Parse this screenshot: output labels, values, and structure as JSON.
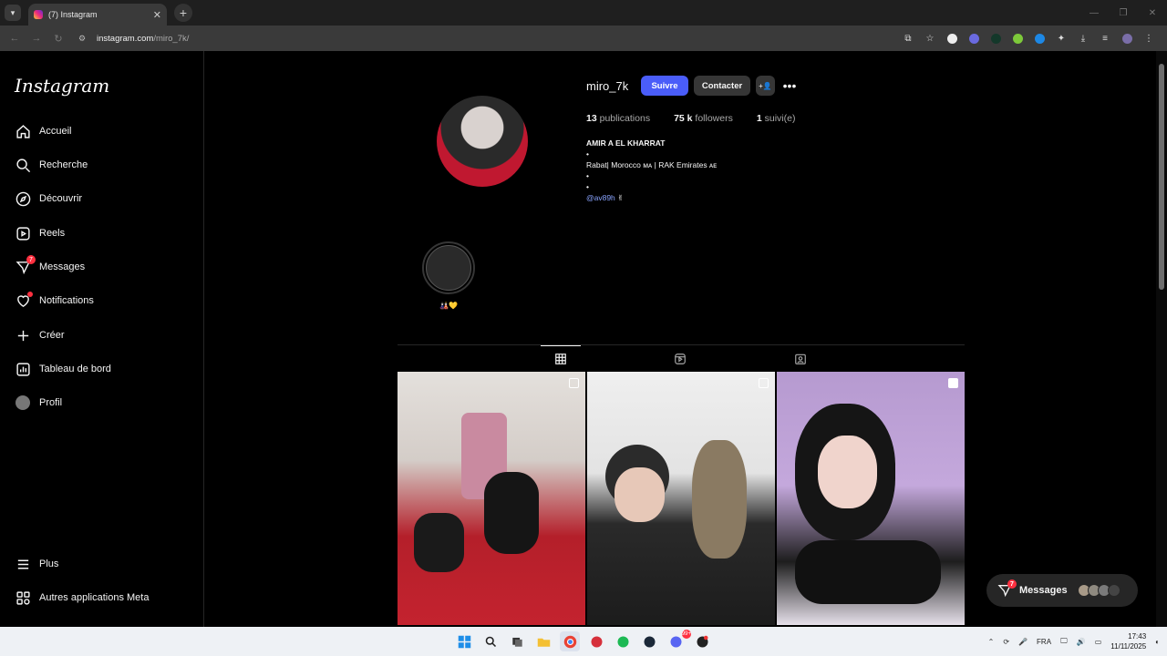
{
  "browser": {
    "tab_title": "(7) Instagram",
    "url_host": "instagram.com",
    "url_path": "/miro_7k/"
  },
  "sidebar": {
    "logo": "Instagram",
    "items": [
      {
        "label": "Accueil",
        "icon": "home-icon"
      },
      {
        "label": "Recherche",
        "icon": "search-icon"
      },
      {
        "label": "Découvrir",
        "icon": "compass-icon"
      },
      {
        "label": "Reels",
        "icon": "reels-icon"
      },
      {
        "label": "Messages",
        "icon": "messenger-icon",
        "badge": "7"
      },
      {
        "label": "Notifications",
        "icon": "heart-icon"
      },
      {
        "label": "Créer",
        "icon": "plus-icon"
      },
      {
        "label": "Tableau de bord",
        "icon": "dashboard-icon"
      },
      {
        "label": "Profil",
        "icon": "avatar"
      }
    ],
    "bottom_items": [
      {
        "label": "Plus",
        "icon": "menu-icon"
      },
      {
        "label": "Autres applications Meta",
        "icon": "meta-apps-icon"
      }
    ]
  },
  "profile": {
    "username": "miro_7k",
    "follow_label": "Suivre",
    "contact_label": "Contacter",
    "stats": {
      "posts_count": "13",
      "posts_label": "publications",
      "followers_count": "75 k",
      "followers_label": "followers",
      "following_count": "1",
      "following_label": "suivi(e)"
    },
    "bio": {
      "name": "AMIR A EL KHARRAT",
      "line1": "•",
      "line2": "Rabat| Morocco ᴍᴀ | RAK Emirates ᴀᴇ",
      "line3": "•",
      "line4": "•",
      "link": "@av89h",
      "link_suffix": "✌"
    },
    "highlight_label": "🎎💛"
  },
  "messages_pill": {
    "label": "Messages",
    "badge": "7"
  },
  "taskbar": {
    "lang": "FRA",
    "time": "17:43",
    "date": "11/11/2025",
    "discord_badge": "99+"
  },
  "colors": {
    "follow_button": "#4a5df9",
    "badge": "#ff3040",
    "link": "#8aa4ff"
  }
}
